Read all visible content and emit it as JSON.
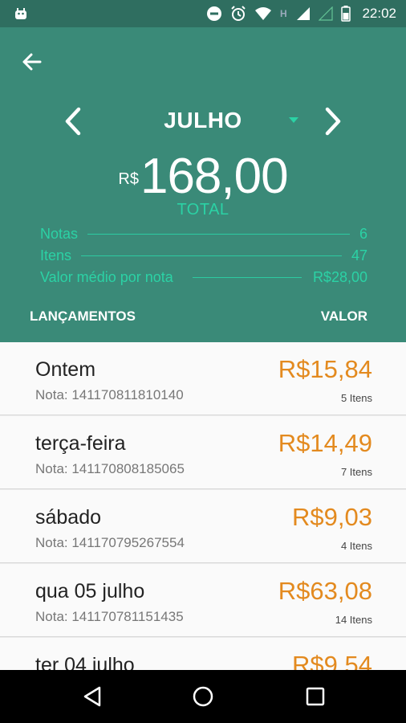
{
  "status_bar": {
    "time": "22:02"
  },
  "header": {
    "month": "JULHO",
    "currency": "R$",
    "total": "168,00",
    "total_label": "TOTAL",
    "stats": [
      {
        "label": "Notas",
        "value": "6"
      },
      {
        "label": "Itens",
        "value": "47"
      },
      {
        "label": "Valor médio por nota",
        "value": "R$28,00"
      }
    ],
    "col_left": "LANÇAMENTOS",
    "col_right": "VALOR"
  },
  "entries": [
    {
      "title": "Ontem",
      "note": "Nota: 141170811810140",
      "value": "R$15,84",
      "count": "5 Itens"
    },
    {
      "title": "terça-feira",
      "note": "Nota: 141170808185065",
      "value": "R$14,49",
      "count": "7 Itens"
    },
    {
      "title": "sábado",
      "note": "Nota: 141170795267554",
      "value": "R$9,03",
      "count": "4 Itens"
    },
    {
      "title": "qua 05 julho",
      "note": "Nota: 141170781151435",
      "value": "R$63,08",
      "count": "14 Itens"
    },
    {
      "title": "ter 04 julho",
      "note": "",
      "value": "R$9,54",
      "count": ""
    }
  ],
  "colors": {
    "header": "#3a8a78",
    "status_bar": "#2f6e60",
    "accent": "#2bd2a5",
    "value": "#e38a1f"
  },
  "icons": [
    "android-icon",
    "dnd-icon",
    "alarm-icon",
    "wifi-icon",
    "signal-icon",
    "battery-icon",
    "back-arrow-icon",
    "chevron-left-icon",
    "chevron-right-icon",
    "dropdown-icon",
    "nav-back-icon",
    "nav-home-icon",
    "nav-recents-icon"
  ]
}
